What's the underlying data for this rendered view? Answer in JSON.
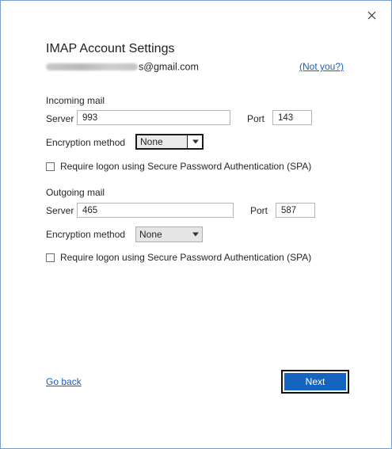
{
  "dialog": {
    "title": "IMAP Account Settings",
    "email_domain": "s@gmail.com",
    "not_you_label": "(Not you?)"
  },
  "incoming": {
    "section_label": "Incoming mail",
    "server_label": "Server",
    "server_value": "993",
    "port_label": "Port",
    "port_value": "143",
    "encryption_label": "Encryption method",
    "encryption_value": "None",
    "spa_label": "Require logon using Secure Password Authentication (SPA)",
    "spa_checked": false
  },
  "outgoing": {
    "section_label": "Outgoing mail",
    "server_label": "Server",
    "server_value": "465",
    "port_label": "Port",
    "port_value": "587",
    "encryption_label": "Encryption method",
    "encryption_value": "None",
    "spa_label": "Require logon using Secure Password Authentication (SPA)",
    "spa_checked": false
  },
  "footer": {
    "go_back_label": "Go back",
    "next_label": "Next"
  },
  "icons": {
    "close": "close-icon",
    "dropdown": "chevron-down-icon",
    "blurred_email": "redacted-text"
  },
  "colors": {
    "accent": "#1565c0",
    "link": "#1a5fb4",
    "border": "#7a9cc6"
  }
}
